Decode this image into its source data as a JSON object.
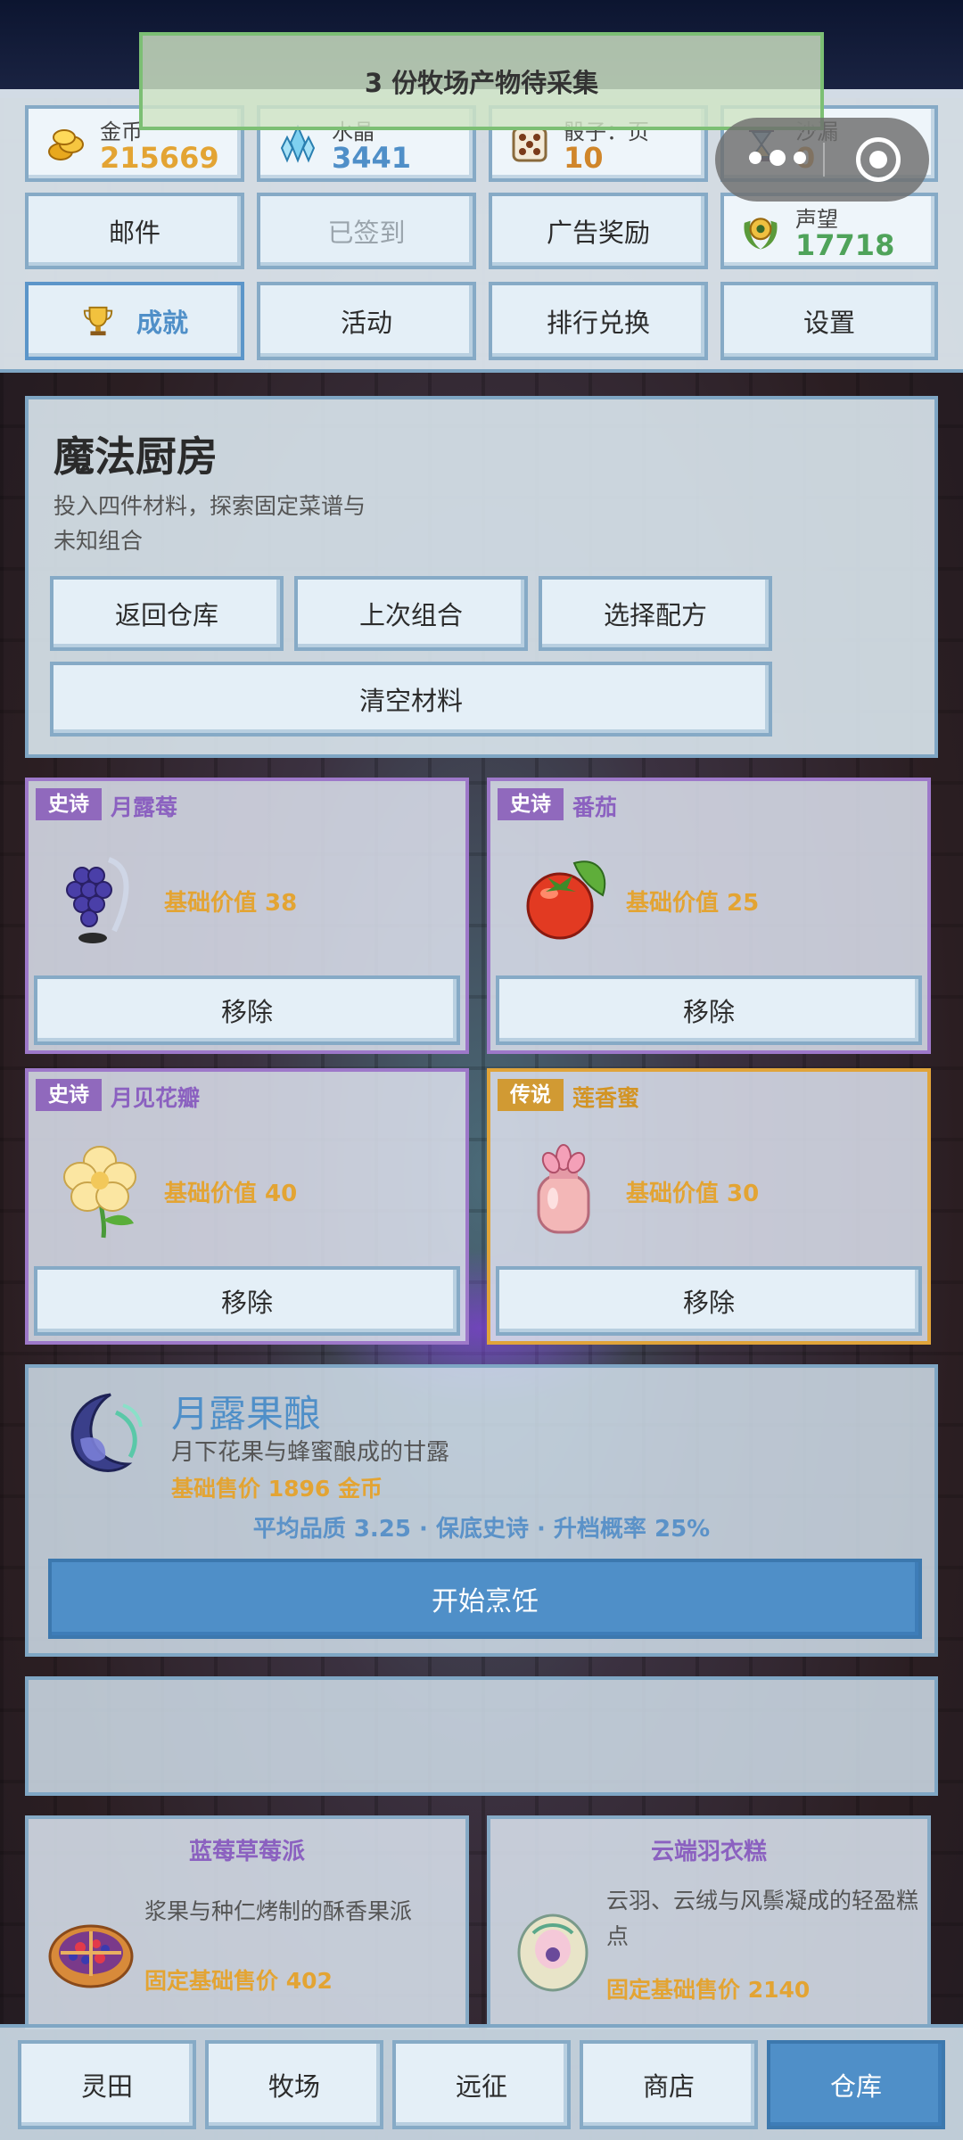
{
  "toast": "3 份牧场产物待采集",
  "stats": {
    "gold": {
      "label": "金币",
      "value": "215669",
      "color": "#e3a433"
    },
    "crystal": {
      "label": "水晶",
      "value": "3441",
      "color": "#4f8fc8"
    },
    "dice": {
      "label": "骰子：页",
      "value": "10",
      "color": "#d0862a"
    },
    "hourglass": {
      "label": "沙漏",
      "value": "0",
      "color": "#d0862a"
    },
    "reputation": {
      "label": "声望",
      "value": "17718",
      "color": "#4fa35a"
    }
  },
  "header_buttons": {
    "mail": "邮件",
    "signed_in": "已签到",
    "ad_reward": "广告奖励",
    "achievements": "成就",
    "events": "活动",
    "ranking": "排行兑换",
    "settings": "设置"
  },
  "kitchen": {
    "title": "魔法厨房",
    "description": "投入四件材料，探索固定菜谱与未知组合",
    "buttons": {
      "back": "返回仓库",
      "last_combo": "上次组合",
      "choose_recipe": "选择配方",
      "clear": "清空材料"
    }
  },
  "ingredients": [
    {
      "rarity": "史诗",
      "name": "月露莓",
      "value_text": "基础价值 38",
      "remove": "移除"
    },
    {
      "rarity": "史诗",
      "name": "番茄",
      "value_text": "基础价值 25",
      "remove": "移除"
    },
    {
      "rarity": "史诗",
      "name": "月见花瓣",
      "value_text": "基础价值 40",
      "remove": "移除"
    },
    {
      "rarity": "传说",
      "name": "莲香蜜",
      "value_text": "基础价值 30",
      "remove": "移除"
    }
  ],
  "result": {
    "title": "月露果酿",
    "description": "月下花果与蜂蜜酿成的甘露",
    "price": "基础售价 1896 金币",
    "stats": "平均品质 3.25 · 保底史诗 · 升档概率 25%",
    "cook_button": "开始烹饪"
  },
  "recipes": [
    {
      "name": "蓝莓草莓派",
      "description": "浆果与种仁烤制的酥香果派",
      "price": "固定基础售价 402"
    },
    {
      "name": "云端羽衣糕",
      "description": "云羽、云绒与风鬃凝成的轻盈糕点",
      "price": "固定基础售价 2140"
    }
  ],
  "nav": {
    "field": "灵田",
    "ranch": "牧场",
    "expedition": "远征",
    "shop": "商店",
    "warehouse": "仓库"
  },
  "colors": {
    "accent_blue": "#4f8fc8",
    "gold_text": "#e3a433",
    "epic_purple": "#9069bd",
    "legend_orange": "#d19a33"
  }
}
